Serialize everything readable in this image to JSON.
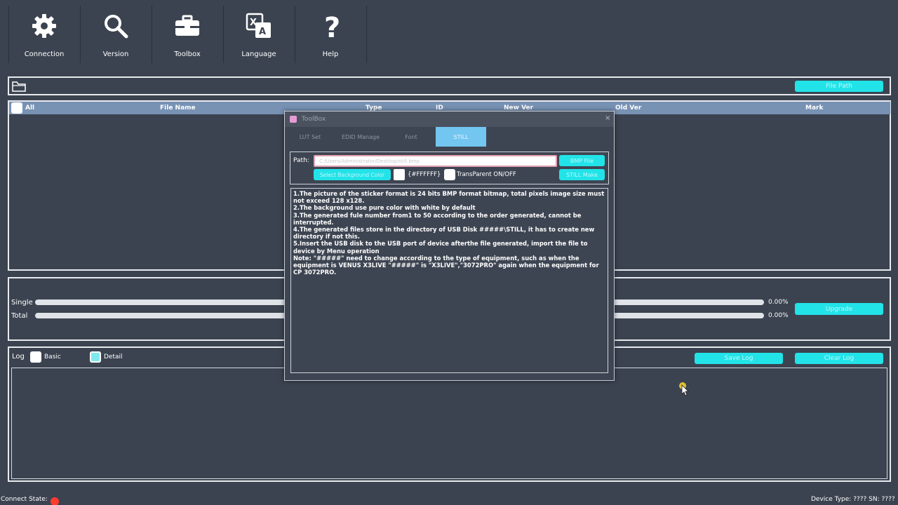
{
  "toolbar": {
    "items": [
      {
        "label": "Connection",
        "icon": "gear-icon"
      },
      {
        "label": "Version",
        "icon": "search-icon"
      },
      {
        "label": "Toolbox",
        "icon": "toolbox-icon"
      },
      {
        "label": "Language",
        "icon": "translate-icon"
      },
      {
        "label": "Help",
        "icon": "help-icon"
      }
    ]
  },
  "file_bar": {
    "open_button": "File Path"
  },
  "table": {
    "columns": {
      "all": "All",
      "file_name": "File Name",
      "type": "Type",
      "id": "ID",
      "new_ver": "New Ver",
      "old_ver": "Old Ver",
      "mark": "Mark"
    }
  },
  "progress": {
    "single_label": "Single",
    "total_label": "Total",
    "single_pct": "0.00%",
    "total_pct": "0.00%",
    "upgrade_button": "Upgrade"
  },
  "log": {
    "label": "Log",
    "basic_label": "Basic",
    "detail_label": "Detail",
    "save_button": "Save Log",
    "clear_button": "Clear Log"
  },
  "status": {
    "connect_state": "Connect State:",
    "device_info": "Device Type: ???? SN: ????",
    "connect_color": "#ff3b30"
  },
  "dialog": {
    "title": "ToolBox",
    "tabs": [
      "LUT Set",
      "EDID Manage",
      "Font",
      "STILL"
    ],
    "active_tab": "STILL",
    "path_label": "Path:",
    "path_value": "C:/Users/Administrator/Desktop/still.bmp",
    "bmp_button": "BMP File",
    "bg_color_button": "Select Background Color",
    "color_value": "{#FFFFFF}",
    "transparent_label": "TransParent ON/OFF",
    "still_make_button": "STILL Make",
    "notes": "1.The picture of the sticker format is 24 bits BMP format bitmap, total pixels image size must not exceed 128 x128.\n2.The background use pure color with white by default\n3.The generated fule number from1 to 50 according to the order generated, cannot be interrupted.\n4.The generated files store in the directory of USB Disk #####\\STILL, it has to create new directory if not this.\n5.Insert the USB disk to the USB port of device afterthe file generated, import the file to device by Menu operation\nNote: \"#####\" need to change according to the type of equipment, such as when the equipment is VENUS X3LIVE \"#####\" is \"X3LIVE\",\"3072PRO\" again when the equipment for CP 3072PRO."
  },
  "colors": {
    "accent_cyan": "#22e3e8",
    "table_header": "#7892b4",
    "active_tab": "#73c6f0",
    "background": "#3b4350"
  }
}
